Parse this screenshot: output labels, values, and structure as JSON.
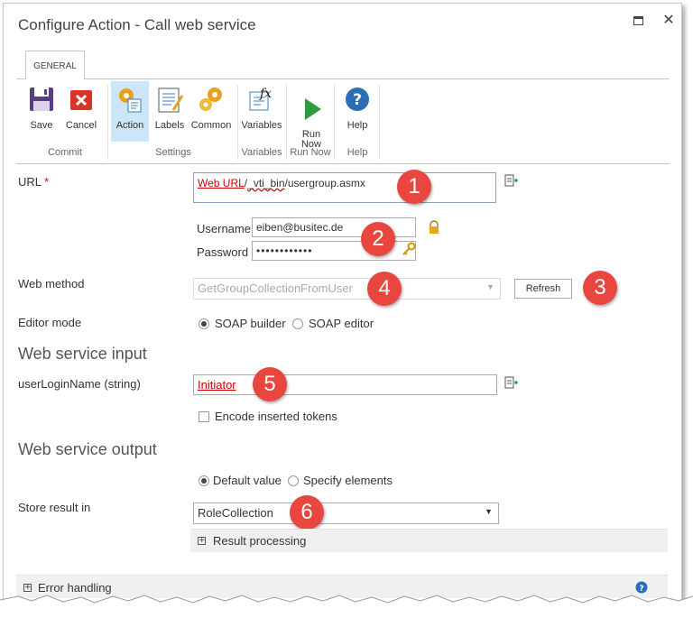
{
  "window": {
    "title": "Configure Action - Call web service"
  },
  "tab": {
    "label": "GENERAL"
  },
  "ribbon": {
    "save": "Save",
    "cancel": "Cancel",
    "action": "Action",
    "labels": "Labels",
    "common": "Common",
    "variables": "Variables",
    "run_now": "Run\nNow",
    "help": "Help",
    "groups": {
      "commit": "Commit",
      "settings": "Settings",
      "variables": "Variables",
      "run_now": "Run Now",
      "help": "Help"
    }
  },
  "form": {
    "url_label": "URL",
    "url_required": "*",
    "url_value_token": "Web URL",
    "url_value_sep": "/",
    "url_value_rest1": "_vti_bin",
    "url_value_rest2": "/usergroup.asmx",
    "username_label": "Username",
    "username_value": "eiben@busitec.de",
    "password_label": "Password",
    "password_value": "••••••••••••",
    "web_method_label": "Web method",
    "web_method_value": "GetGroupCollectionFromUser",
    "refresh_button": "Refresh",
    "editor_mode_label": "Editor mode",
    "soap_builder": "SOAP builder",
    "soap_editor": "SOAP editor",
    "input_section": "Web service input",
    "param_label": "userLoginName (string)",
    "param_value": "Initiator",
    "encode_tokens": "Encode inserted tokens",
    "output_section": "Web service output",
    "default_value": "Default value",
    "specify_elements": "Specify elements",
    "store_result_label": "Store result in",
    "store_result_value": "RoleCollection",
    "result_processing": "Result processing",
    "error_handling": "Error handling"
  },
  "callouts": [
    "1",
    "2",
    "3",
    "4",
    "5",
    "6"
  ],
  "colors": {
    "accent": "#0072c6",
    "callout": "#e8463f",
    "token": "#cc0000"
  }
}
